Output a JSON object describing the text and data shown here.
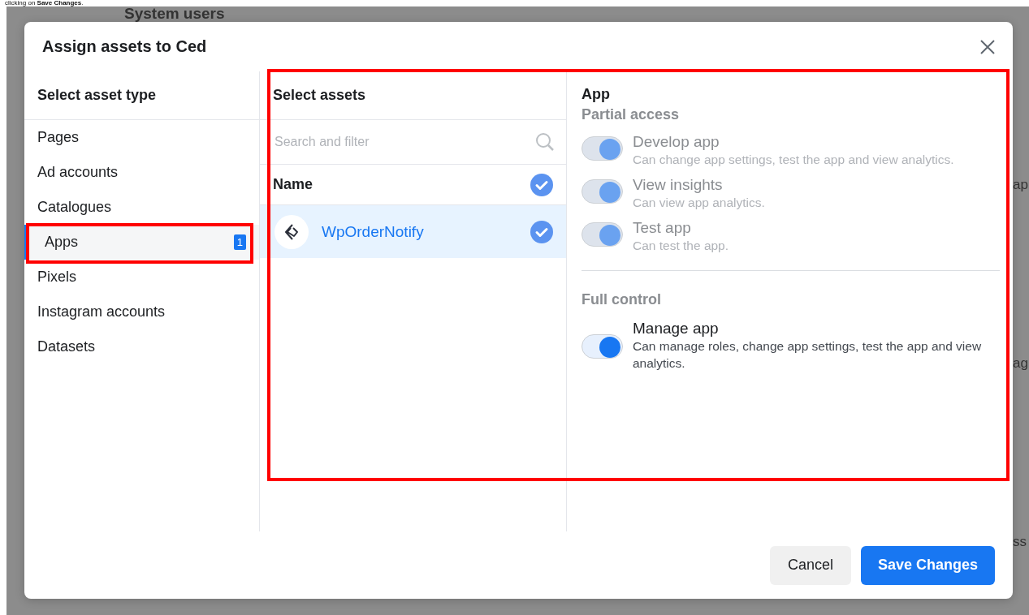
{
  "caption": "clicking on **Save Changes**.",
  "background": {
    "title": "System users",
    "fragments": [
      "ap",
      "ag",
      "ss"
    ]
  },
  "dialog": {
    "title": "Assign assets to Ced",
    "asset_types": {
      "heading": "Select asset type",
      "items": [
        {
          "label": "Pages",
          "selected": false,
          "highlighted": false
        },
        {
          "label": "Ad accounts",
          "selected": false,
          "highlighted": false
        },
        {
          "label": "Catalogues",
          "selected": false,
          "highlighted": false
        },
        {
          "label": "Apps",
          "selected": true,
          "highlighted": true,
          "count": "1"
        },
        {
          "label": "Pixels",
          "selected": false,
          "highlighted": false
        },
        {
          "label": "Instagram accounts",
          "selected": false,
          "highlighted": false
        },
        {
          "label": "Datasets",
          "selected": false,
          "highlighted": false
        }
      ]
    },
    "assets": {
      "heading": "Select assets",
      "highlighted": true,
      "search": {
        "placeholder": "Search and filter"
      },
      "column": {
        "label": "Name",
        "checked": true
      },
      "rows": [
        {
          "name": "WpOrderNotify",
          "selected": true,
          "checked": true
        }
      ]
    },
    "permissions": {
      "heading": "App",
      "groups": [
        {
          "title": "Partial access",
          "items": [
            {
              "label": "Develop app",
              "description": "Can change app settings, test the app and view analytics.",
              "on": true,
              "disabled": true
            },
            {
              "label": "View insights",
              "description": "Can view app analytics.",
              "on": true,
              "disabled": true
            },
            {
              "label": "Test app",
              "description": "Can test the app.",
              "on": true,
              "disabled": true
            }
          ]
        },
        {
          "title": "Full control",
          "items": [
            {
              "label": "Manage app",
              "description": "Can manage roles, change app settings, test the app and view analytics.",
              "on": true,
              "disabled": false
            }
          ]
        }
      ]
    },
    "buttons": [
      {
        "label": "Cancel",
        "kind": "secondary"
      },
      {
        "label": "Save Changes",
        "kind": "primary"
      }
    ]
  }
}
